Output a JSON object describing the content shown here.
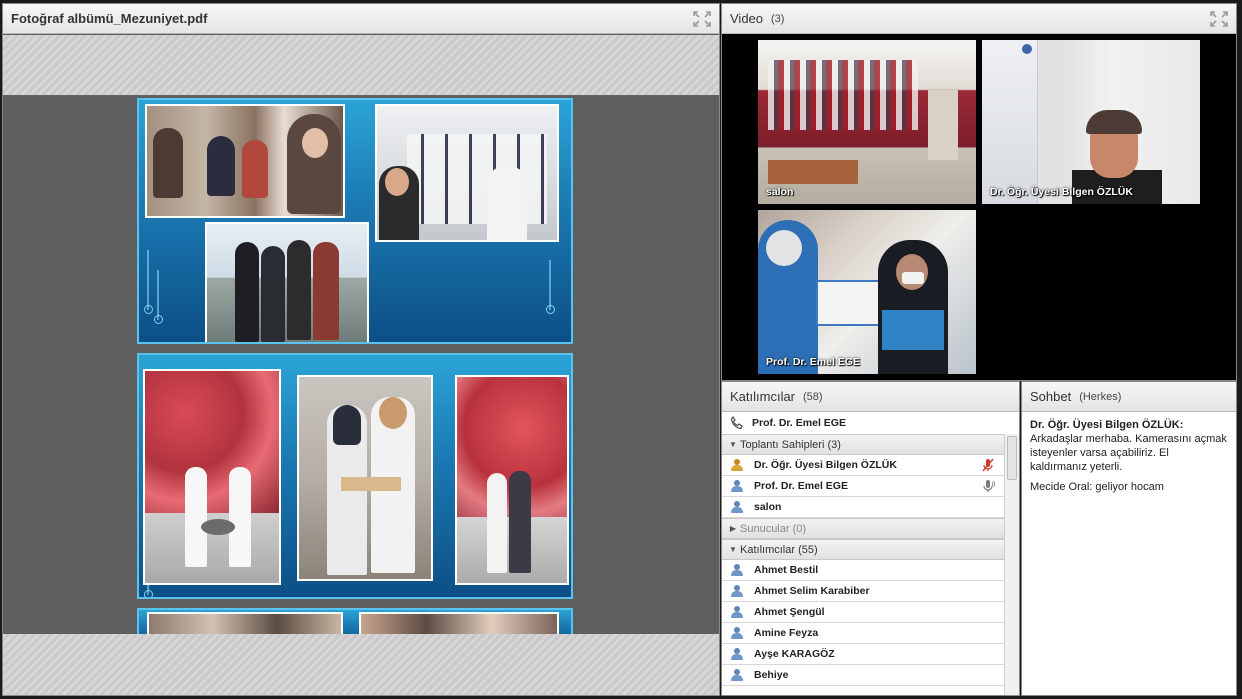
{
  "share_pod": {
    "title": "Fotoğraf albümü_Mezuniyet.pdf"
  },
  "video_pod": {
    "title": "Video",
    "count": "(3)",
    "tiles": [
      {
        "name": "salon"
      },
      {
        "name": "Dr. Öğr. Üyesi Bilgen ÖZLÜK"
      },
      {
        "name": "Prof. Dr. Emel EGE"
      }
    ]
  },
  "attendee_pod": {
    "title": "Katılımcılar",
    "count": "(58)",
    "current_user": "Prof. Dr. Emel EGE",
    "sections": {
      "hosts": {
        "label": "Toplantı Sahipleri (3)",
        "members": [
          {
            "name": "Dr. Öğr. Üyesi Bilgen ÖZLÜK",
            "status": "mic-muted-icon"
          },
          {
            "name": "Prof. Dr. Emel EGE",
            "status": "mic-on-icon"
          },
          {
            "name": "salon",
            "status": ""
          }
        ]
      },
      "presenters": {
        "label": "Sunucular (0)"
      },
      "participants": {
        "label": "Katılımcılar (55)",
        "members": [
          {
            "name": "Ahmet Bestil"
          },
          {
            "name": "Ahmet Selim Karabiber"
          },
          {
            "name": "Ahmet Şengül"
          },
          {
            "name": "Amine Feyza"
          },
          {
            "name": "Ayşe KARAGÖZ"
          },
          {
            "name": "Behiye"
          }
        ]
      }
    }
  },
  "chat_pod": {
    "title": "Sohbet",
    "audience": "(Herkes)",
    "messages": [
      {
        "sender": "Dr. Öğr. Üyesi Bilgen ÖZLÜK:",
        "text": "Arkadaşlar merhaba. Kamerasını açmak isteyenler varsa açabiliriz. El kaldırmanız yeterli."
      },
      {
        "sender": "Mecide Oral:",
        "text": "geliyor hocam"
      }
    ]
  },
  "colors": {
    "host_icon": "#d9a43a",
    "participant_icon": "#6f98c8",
    "mic_muted": "#d23a2a",
    "slide_blue": "#1b78b2"
  }
}
